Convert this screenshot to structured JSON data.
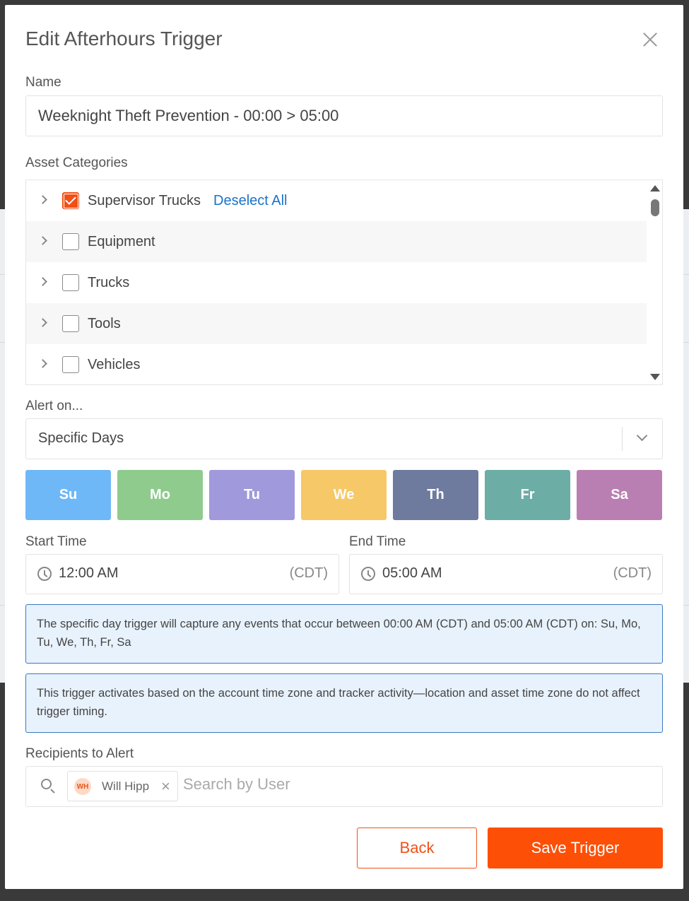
{
  "modal": {
    "title": "Edit Afterhours Trigger"
  },
  "name": {
    "label": "Name",
    "value": "Weeknight Theft Prevention - 00:00 > 05:00"
  },
  "categories": {
    "label": "Asset Categories",
    "deselect_all": "Deselect All",
    "items": [
      {
        "label": "Supervisor Trucks",
        "checked": true
      },
      {
        "label": "Equipment",
        "checked": false
      },
      {
        "label": "Trucks",
        "checked": false
      },
      {
        "label": "Tools",
        "checked": false
      },
      {
        "label": "Vehicles",
        "checked": false
      }
    ]
  },
  "alert_on": {
    "label": "Alert on...",
    "selected": "Specific Days"
  },
  "days": [
    {
      "label": "Su",
      "color": "#6fb8f7"
    },
    {
      "label": "Mo",
      "color": "#8ecb8d"
    },
    {
      "label": "Tu",
      "color": "#a099dc"
    },
    {
      "label": "We",
      "color": "#f7c867"
    },
    {
      "label": "Th",
      "color": "#6e7b9e"
    },
    {
      "label": "Fr",
      "color": "#6cada5"
    },
    {
      "label": "Sa",
      "color": "#ba7fb2"
    }
  ],
  "start_time": {
    "label": "Start Time",
    "value": "12:00 AM",
    "tz": "(CDT)"
  },
  "end_time": {
    "label": "End Time",
    "value": "05:00 AM",
    "tz": "(CDT)"
  },
  "info": {
    "specific_day": "The specific day trigger will capture any events that occur between 00:00 AM (CDT) and 05:00 AM (CDT) on: Su, Mo, Tu, We, Th, Fr, Sa",
    "timezone_note": "This trigger activates based on the account time zone and tracker activity—location and asset time zone do not affect trigger timing."
  },
  "recipients": {
    "label": "Recipients to Alert",
    "placeholder": "Search by User",
    "chips": [
      {
        "initials": "WH",
        "name": "Will Hipp"
      }
    ]
  },
  "buttons": {
    "back": "Back",
    "save": "Save Trigger"
  },
  "colors": {
    "accent": "#fd4f06",
    "link": "#1a73c8",
    "info_bg": "#e8f2fd",
    "info_border": "#3a78c2"
  }
}
